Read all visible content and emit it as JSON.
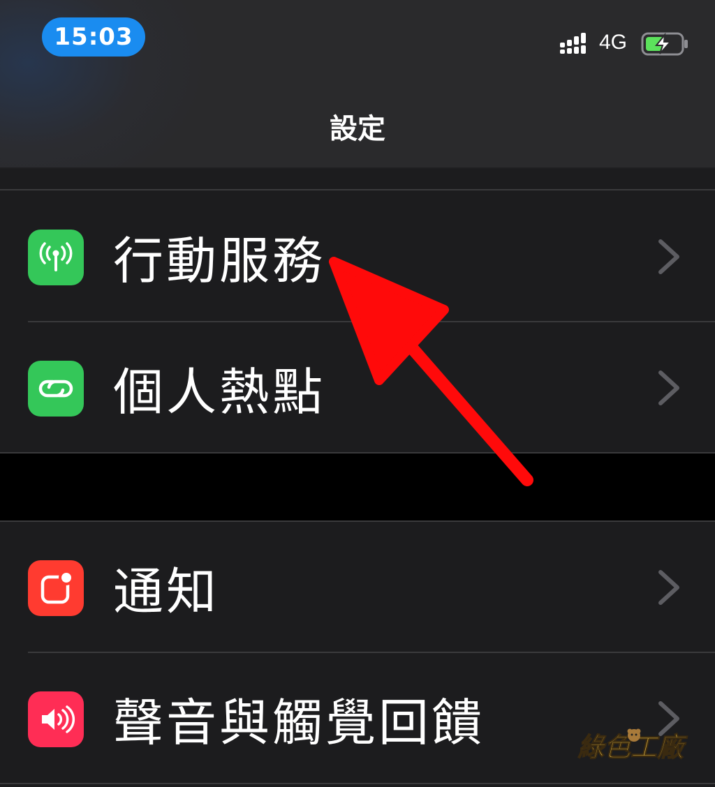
{
  "status_bar": {
    "time": "15:03",
    "network": "4G",
    "time_pill_color": "#1a8cf0",
    "battery_color": "#5ce25c"
  },
  "nav": {
    "title": "設定"
  },
  "groups": [
    {
      "rows": [
        {
          "label": "行動服務",
          "icon": "antenna-icon",
          "icon_color": "#34c759"
        },
        {
          "label": "個人熱點",
          "icon": "hotspot-link-icon",
          "icon_color": "#34c759"
        }
      ]
    },
    {
      "rows": [
        {
          "label": "通知",
          "icon": "notification-icon",
          "icon_color": "#ff3b30"
        },
        {
          "label": "聲音與觸覺回饋",
          "icon": "speaker-icon",
          "icon_color": "#ff2d55"
        }
      ]
    }
  ],
  "annotation": {
    "arrow_color": "#ff0a0a"
  },
  "watermark": {
    "text": "綠色工廠"
  }
}
